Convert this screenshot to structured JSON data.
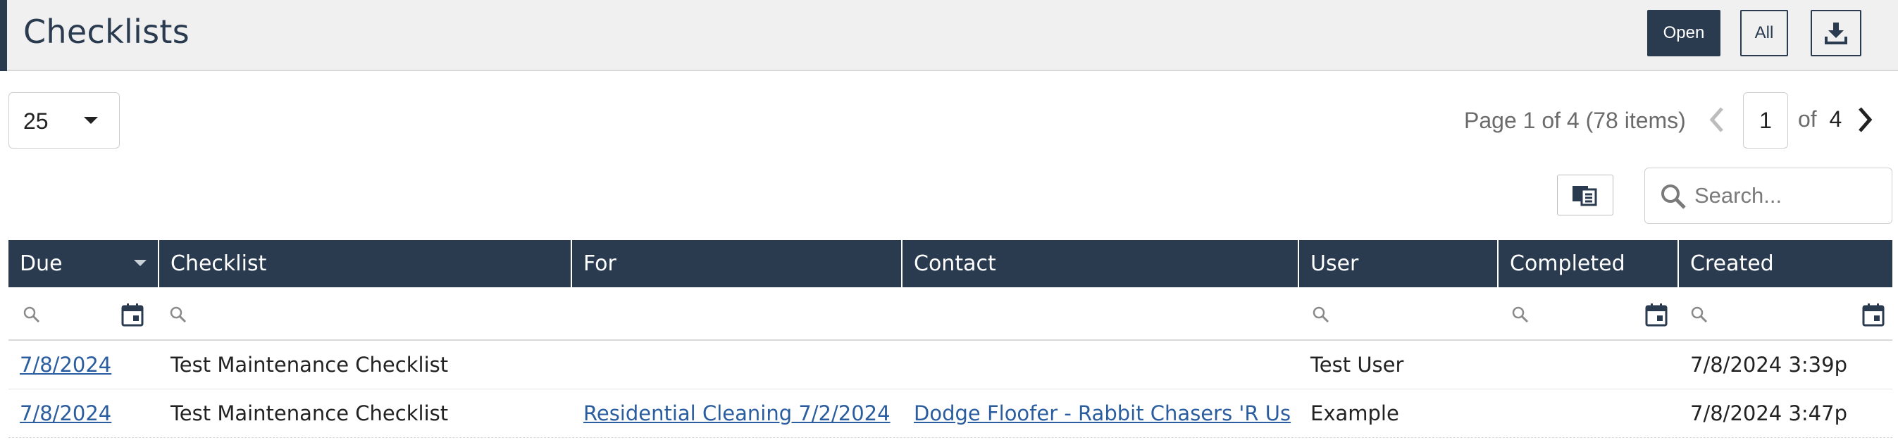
{
  "header": {
    "title": "Checklists",
    "open_label": "Open",
    "all_label": "All",
    "download_icon": "download-icon"
  },
  "pager": {
    "page_size": "25",
    "info": "Page 1 of 4 (78 items)",
    "current_page": "1",
    "of_label": "of",
    "total_pages": "4"
  },
  "toolbar": {
    "search_placeholder": "Search...",
    "columns_icon": "column-chooser-icon"
  },
  "grid": {
    "columns": [
      "Due",
      "Checklist",
      "For",
      "Contact",
      "User",
      "Completed",
      "Created"
    ],
    "sorted_column": "Due",
    "rows": [
      {
        "due": "7/8/2024",
        "checklist": "Test Maintenance Checklist",
        "for": "",
        "contact": "",
        "user": "Test User",
        "completed": "",
        "created": "7/8/2024 3:39p"
      },
      {
        "due": "7/8/2024",
        "checklist": "Test Maintenance Checklist",
        "for": "Residential Cleaning 7/2/2024",
        "contact": "Dodge Floofer - Rabbit Chasers 'R Us",
        "user": "Example",
        "completed": "",
        "created": "7/8/2024 3:47p"
      }
    ]
  },
  "colors": {
    "primary": "#2a3a4f",
    "link": "#2a5d9f",
    "header_bg": "#f0f0f0"
  }
}
